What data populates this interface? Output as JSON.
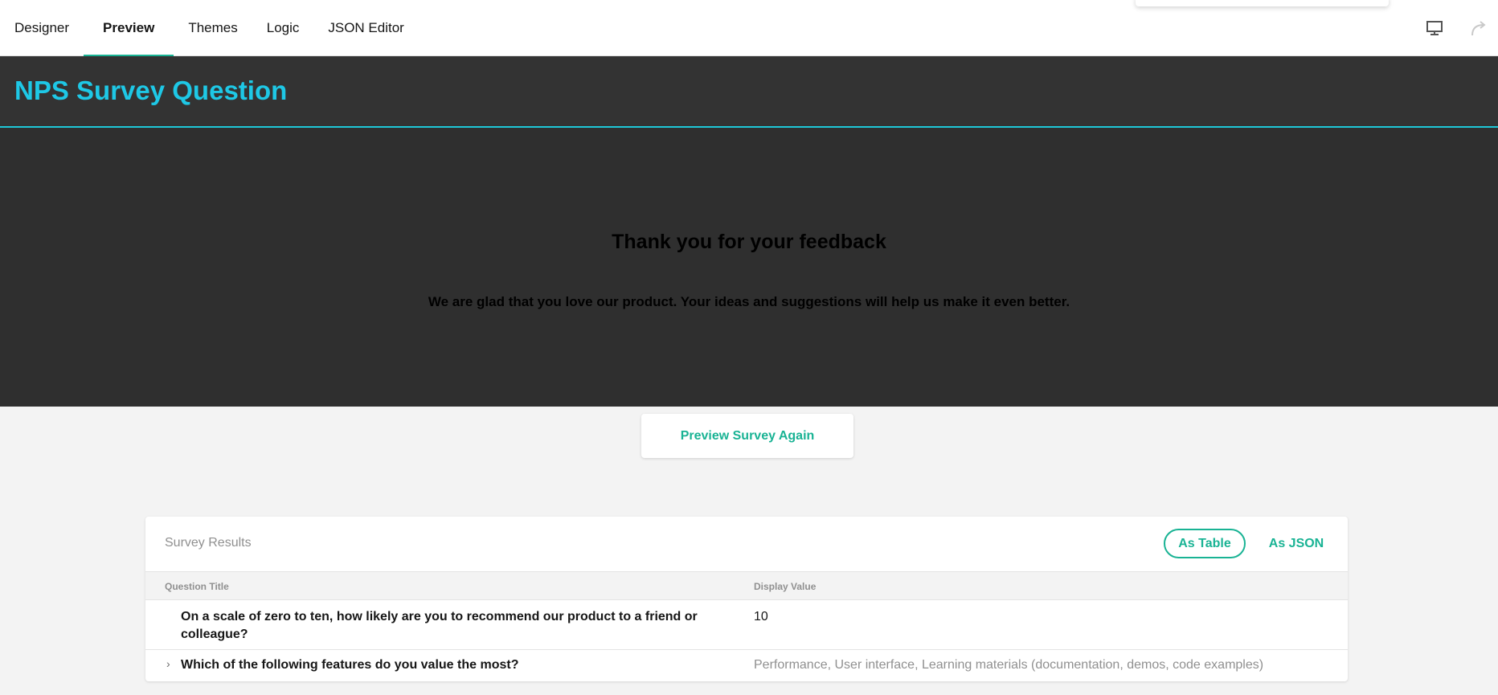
{
  "tabs": [
    {
      "label": "Designer",
      "active": false
    },
    {
      "label": "Preview",
      "active": true
    },
    {
      "label": "Themes",
      "active": false
    },
    {
      "label": "Logic",
      "active": false
    },
    {
      "label": "JSON Editor",
      "active": false
    }
  ],
  "toolbar": {
    "device_icon": "monitor-icon",
    "redo_icon": "redo-icon"
  },
  "survey": {
    "title": "NPS Survey Question"
  },
  "completed": {
    "title": "Thank you for your feedback",
    "text": "We are glad that you love our product. Your ideas and suggestions will help us make it even better."
  },
  "preview_again_label": "Preview Survey Again",
  "results": {
    "title": "Survey Results",
    "as_table_label": "As Table",
    "as_json_label": "As JSON",
    "columns": [
      "Question Title",
      "Display Value"
    ],
    "rows": [
      {
        "question": "On a scale of zero to ten, how likely are you to recommend our product to a friend or colleague?",
        "value": "10"
      },
      {
        "question": "Which of the following features do you value the most?",
        "value": "Performance, User interface, Learning materials (documentation, demos, code examples)"
      }
    ]
  },
  "colors": {
    "accent": "#19b394",
    "title": "#1ec8e6",
    "header_bg": "#333333"
  }
}
